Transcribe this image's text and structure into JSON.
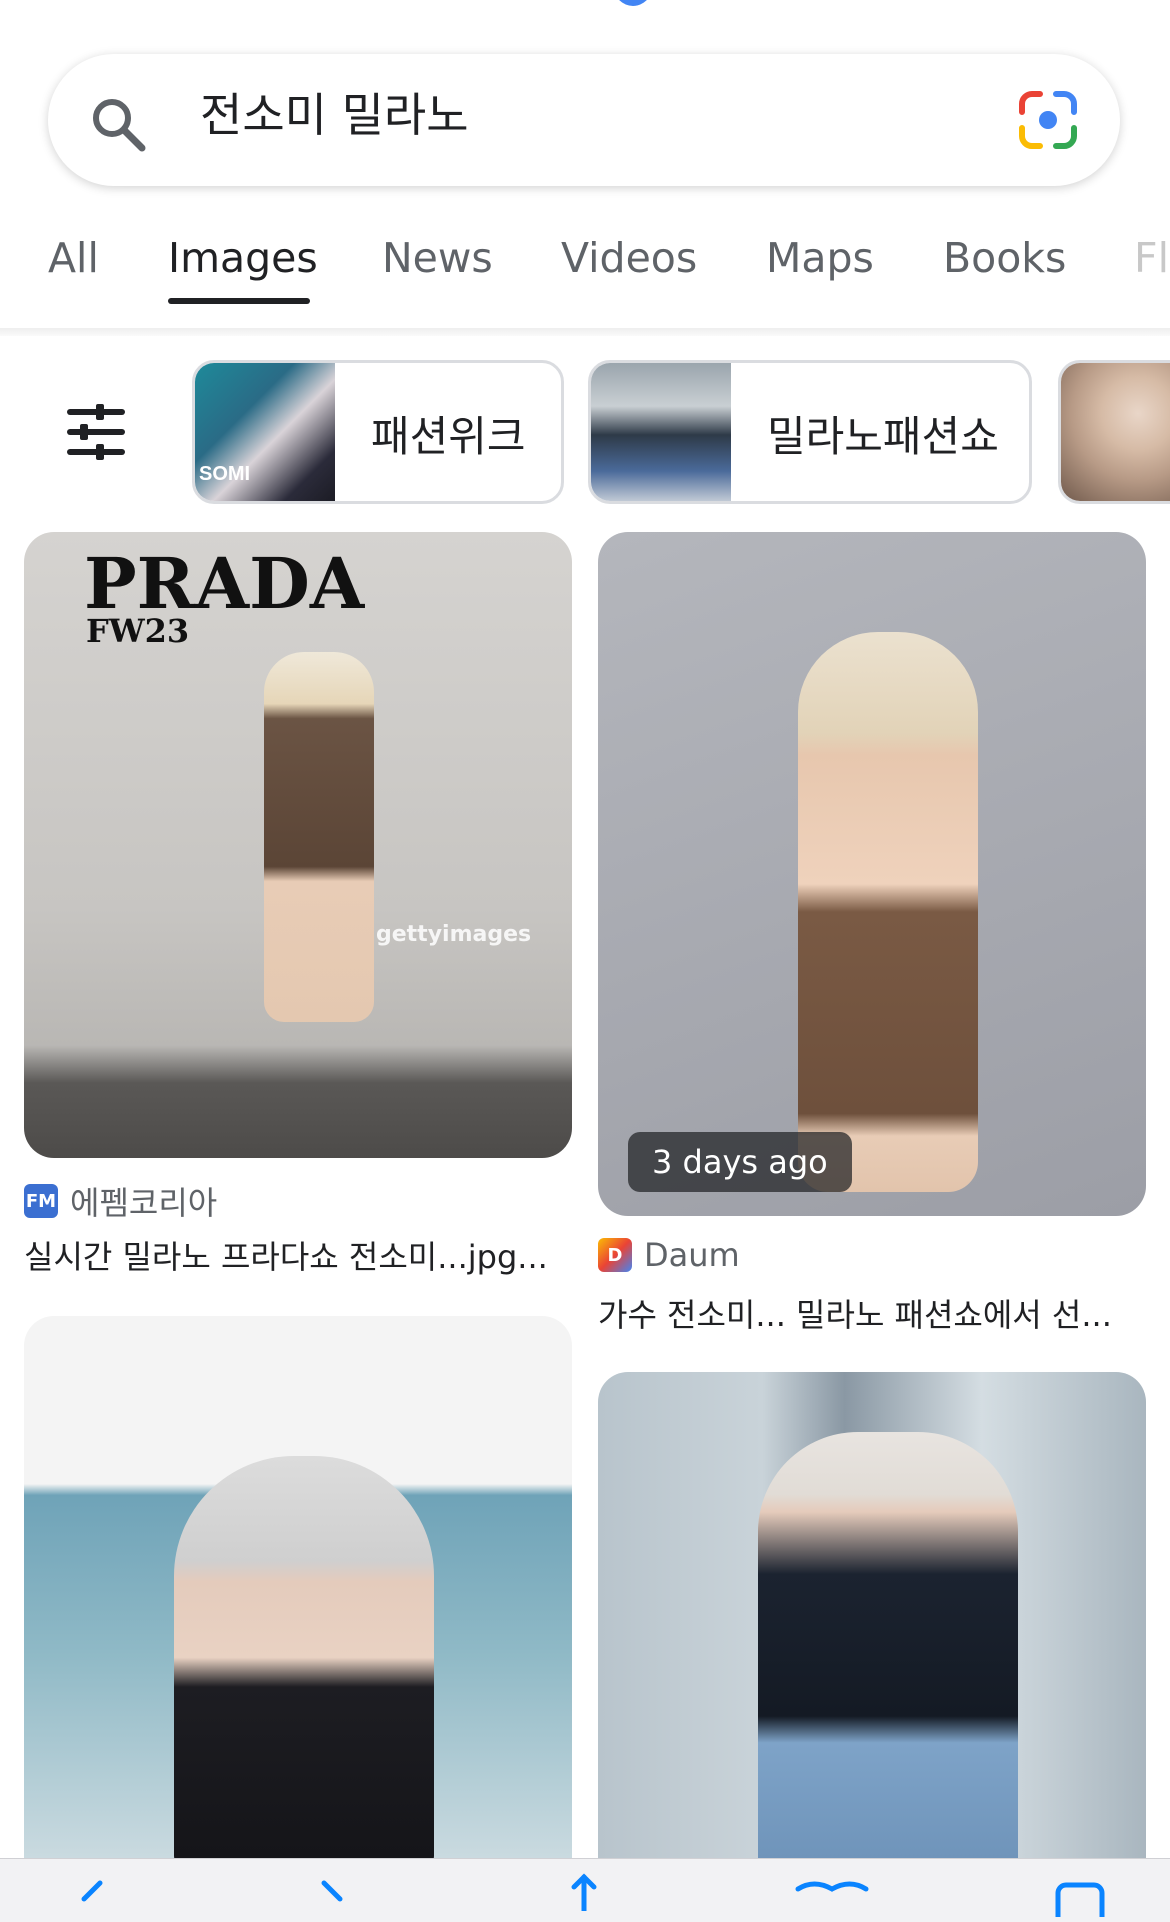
{
  "search": {
    "query": "전소미 밀라노"
  },
  "tabs": [
    {
      "label": "All"
    },
    {
      "label": "Images"
    },
    {
      "label": "News"
    },
    {
      "label": "Videos"
    },
    {
      "label": "Maps"
    },
    {
      "label": "Books"
    },
    {
      "label": "Fl"
    }
  ],
  "chips": [
    {
      "label": "패션위크",
      "thumb_text": "SOMI"
    },
    {
      "label": "밀라노패션쇼"
    }
  ],
  "results": [
    {
      "source": "에펨코리아",
      "favicon": "FM",
      "caption": "실시간 밀라노 프라다쇼 전소미...jpg...",
      "overlay_title": "PRADA",
      "overlay_subtitle": "FW23",
      "watermark": "gettyimages"
    },
    {
      "source": "Daum",
      "favicon": "D",
      "caption": "가수 전소미... 밀라노 패션쇼에서 선...",
      "badge": "3 days ago"
    }
  ],
  "colors": {
    "accent": "#4285f4",
    "active_tab": "#202124",
    "inactive_tab": "#5f6368"
  }
}
